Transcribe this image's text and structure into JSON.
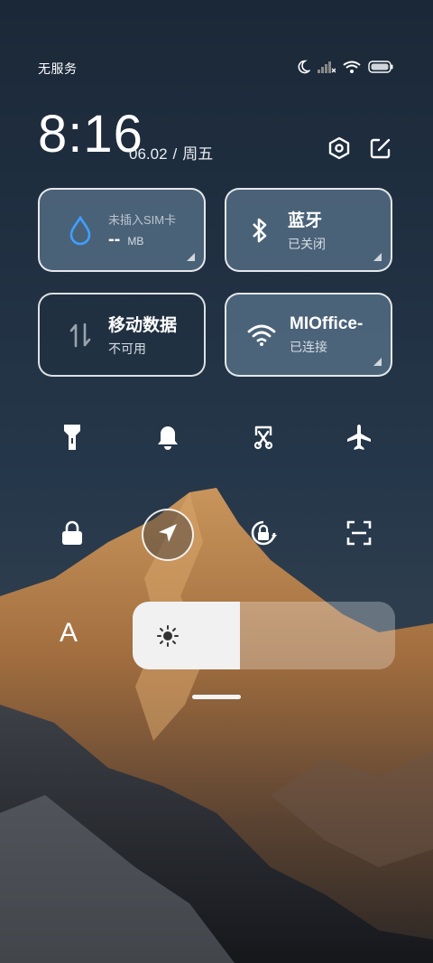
{
  "status_bar": {
    "carrier": "无服务",
    "icons": [
      "moon-icon",
      "signal-icon",
      "wifi-icon",
      "battery-icon"
    ]
  },
  "header": {
    "time": "8:16",
    "date": "06.02",
    "separator": "/",
    "weekday": "周五",
    "icons": [
      "settings-icon",
      "edit-icon"
    ]
  },
  "tiles": {
    "sim": {
      "title": "未插入SIM卡",
      "value": "--",
      "unit": "MB",
      "icon": "water-drop-icon",
      "accent": "#3fa0ff"
    },
    "bluetooth": {
      "title": "蓝牙",
      "subtitle": "已关闭",
      "icon": "bluetooth-icon"
    },
    "mobile_data": {
      "title": "移动数据",
      "subtitle": "不可用",
      "icon": "data-arrows-icon"
    },
    "wifi": {
      "title": "MIOffice-",
      "subtitle": "已连接",
      "icon": "wifi-icon"
    }
  },
  "toggles_row1": [
    "flashlight-icon",
    "bell-icon",
    "screenshot-icon",
    "airplane-icon"
  ],
  "toggles_row2": [
    "lock-icon",
    "location-icon",
    "rotation-lock-icon",
    "scan-icon"
  ],
  "brightness": {
    "auto_label": "A",
    "level": 0.41,
    "icon": "sun-icon"
  }
}
